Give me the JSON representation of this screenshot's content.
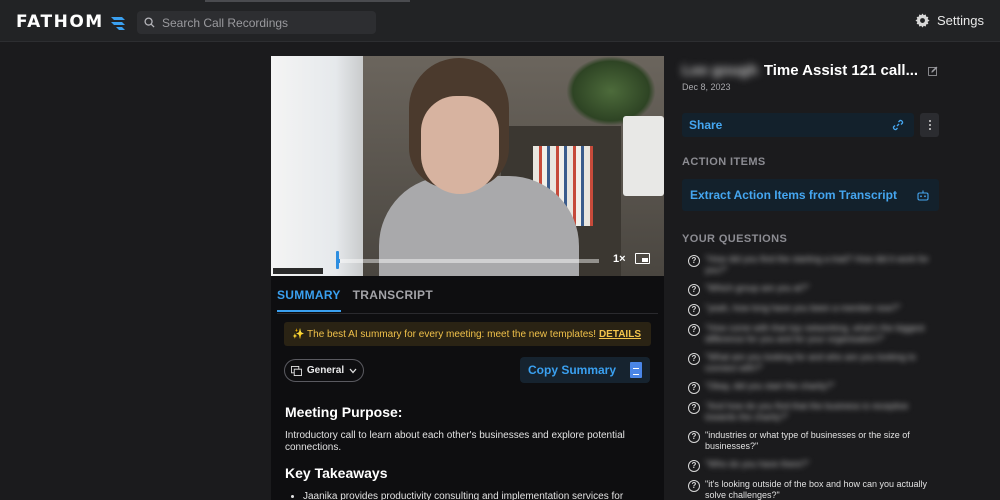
{
  "nav": {
    "logo_text": "FATHOM",
    "search_placeholder": "Search Call Recordings",
    "settings_label": "Settings"
  },
  "video": {
    "speed": "1×",
    "progress_fraction": 0.01
  },
  "tabs": {
    "summary": "SUMMARY",
    "transcript": "TRANSCRIPT"
  },
  "banner": {
    "message": "✨ The best AI summary for every meeting: meet the new templates!",
    "link": "DETAILS"
  },
  "summary_controls": {
    "template_label": "General",
    "copy_label": "Copy Summary"
  },
  "summary": {
    "purpose_heading": "Meeting Purpose:",
    "purpose_text": "Introductory call to learn about each other's businesses and explore potential connections.",
    "takeaways_heading": "Key Takeaways",
    "takeaway_1": "Jaanika provides productivity consulting and implementation services for"
  },
  "call": {
    "name_blurred": "Lee gough",
    "title": "Time Assist 121 call...",
    "date": "Dec 8, 2023"
  },
  "share": {
    "label": "Share"
  },
  "action_items": {
    "heading": "ACTION ITEMS",
    "extract_label": "Extract Action Items from Transcript"
  },
  "questions": {
    "heading": "YOUR QUESTIONS",
    "items": [
      "\"How did you find the starting a trad? How did it work for you?\"",
      "\"Which group are you at?\"",
      "\"yeah, how long have you been a member now?\"",
      "\"How come with that top networking, what's the biggest difference for you and for your organisation?\"",
      "\"What are you looking for and who are you looking to connect with?\"",
      "\"Okay, did you start the charity?\"",
      "\"And how do you find that the business is receptive towards the charity?\"",
      "\"industries or what type of businesses or the size of businesses?\"",
      "\"Who do you have there?\"",
      "\"it's looking outside of the box and how can you actually solve challenges?\""
    ]
  },
  "colors": {
    "accent": "#3aa0f0",
    "banner_text": "#f0c14a",
    "background": "#1b1b1d",
    "panel": "#0e0e10"
  }
}
